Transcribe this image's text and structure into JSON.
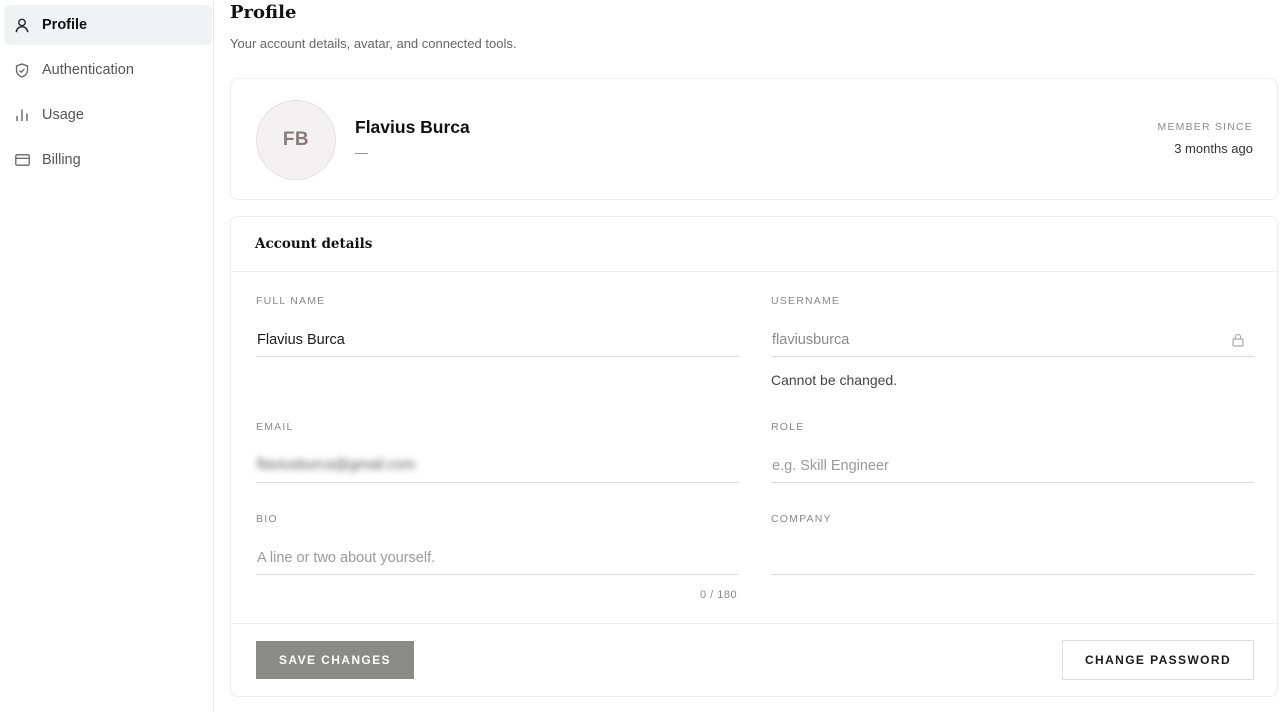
{
  "sidebar": {
    "items": [
      {
        "label": "Profile",
        "icon": "user-icon",
        "active": true
      },
      {
        "label": "Authentication",
        "icon": "shield-icon",
        "active": false
      },
      {
        "label": "Usage",
        "icon": "bar-chart-icon",
        "active": false
      },
      {
        "label": "Billing",
        "icon": "credit-card-icon",
        "active": false
      }
    ]
  },
  "header": {
    "title": "Profile",
    "subtitle": "Your account details, avatar, and connected tools."
  },
  "profile": {
    "initials": "FB",
    "name": "Flavius Burca",
    "secondary": "—",
    "member_since_label": "MEMBER SINCE",
    "member_since_value": "3 months ago"
  },
  "account": {
    "title": "Account details",
    "full_name": {
      "label": "FULL NAME",
      "value": "Flavius Burca"
    },
    "username": {
      "label": "USERNAME",
      "value": "flaviusburca",
      "helper": "Cannot be changed.",
      "icon": "lock-icon"
    },
    "email": {
      "label": "EMAIL",
      "value": "flaviusburca@gmail.com",
      "blurred": true
    },
    "role": {
      "label": "ROLE",
      "value": "",
      "placeholder": "e.g. Skill Engineer"
    },
    "bio": {
      "label": "BIO",
      "value": "",
      "placeholder": "A line or two about yourself.",
      "counter": "0 / 180"
    },
    "company": {
      "label": "COMPANY",
      "value": "",
      "placeholder": ""
    }
  },
  "actions": {
    "save_label": "SAVE CHANGES",
    "change_password_label": "CHANGE PASSWORD"
  },
  "colors": {
    "save_button_bg": "#8a8a88",
    "active_nav_bg": "#f1f2f3"
  }
}
